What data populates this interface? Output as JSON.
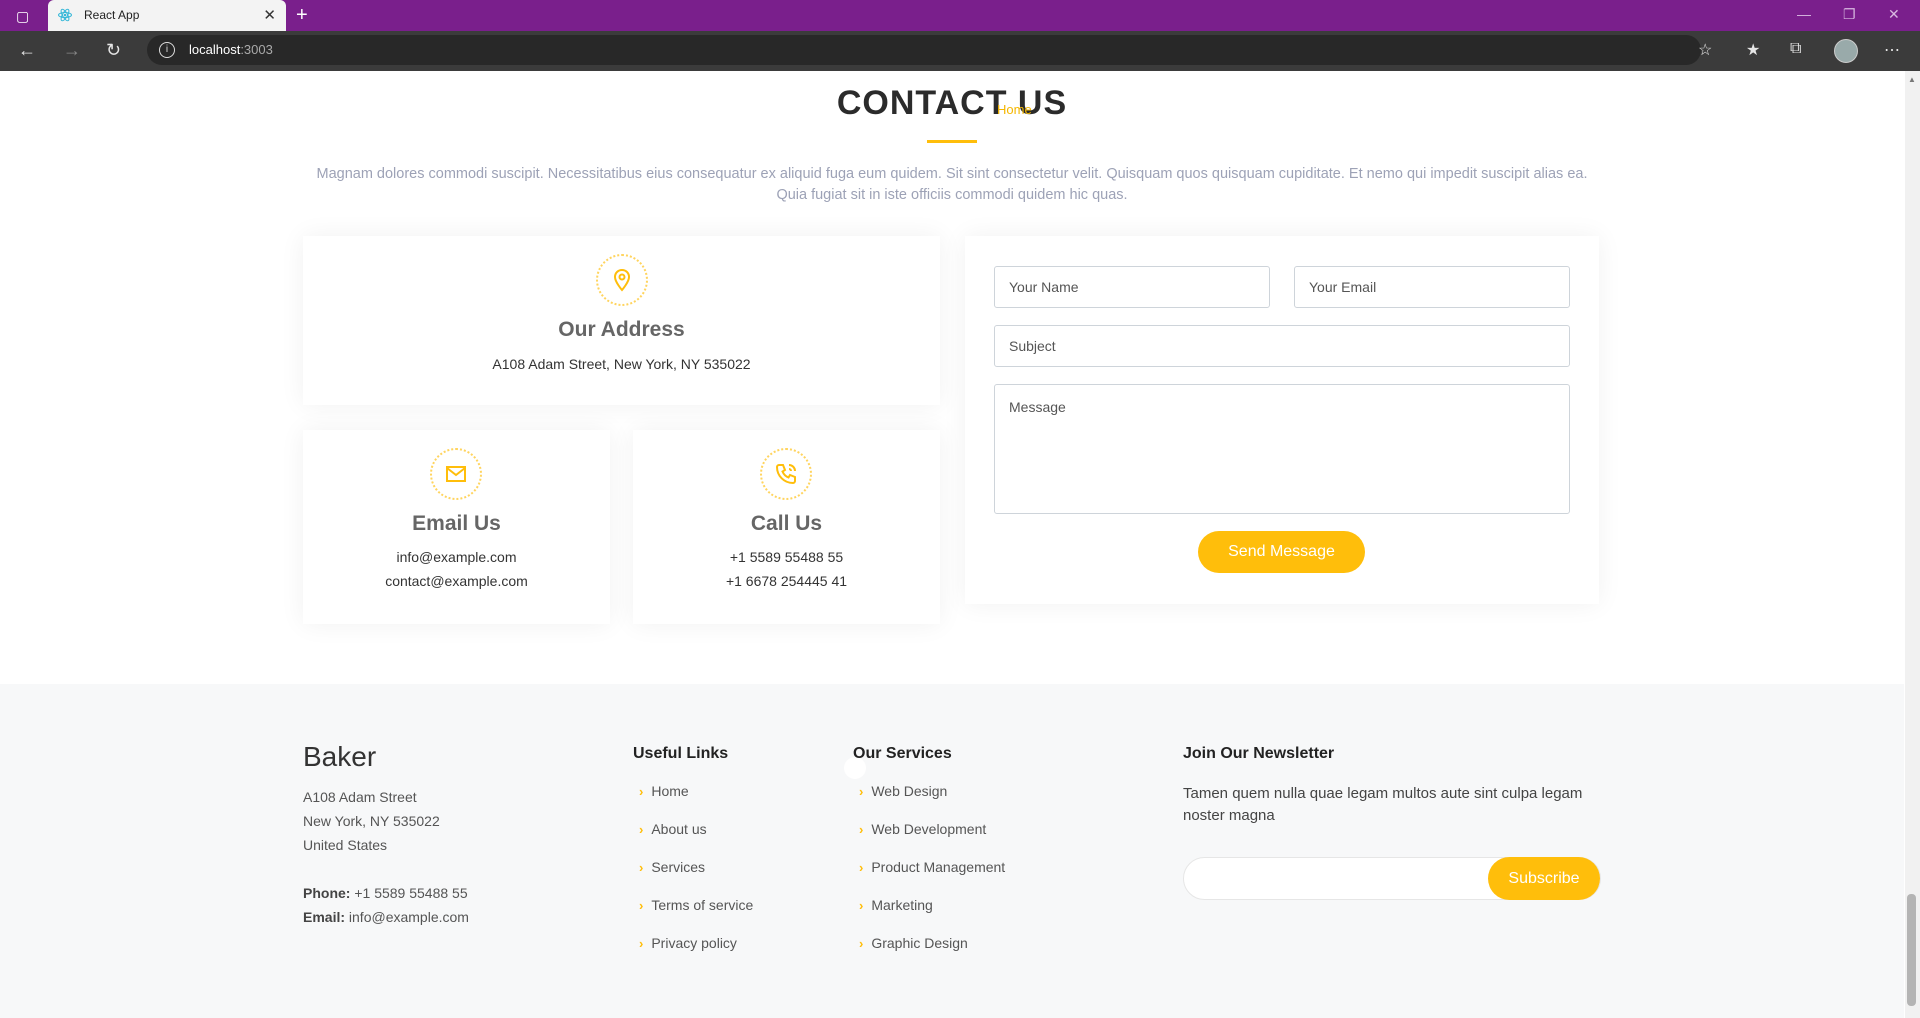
{
  "browser": {
    "tab_title": "React App",
    "url_host": "localhost",
    "url_port": ":3003"
  },
  "section": {
    "title": "CONTACT US",
    "overlay_link": "Home",
    "description": "Magnam dolores commodi suscipit. Necessitatibus eius consequatur ex aliquid fuga eum quidem. Sit sint consectetur velit. Quisquam quos quisquam cupiditate. Et nemo qui impedit suscipit alias ea. Quia fugiat sit in iste officiis commodi quidem hic quas."
  },
  "info": {
    "address": {
      "title": "Our Address",
      "text": "A108 Adam Street, New York, NY 535022"
    },
    "email": {
      "title": "Email Us",
      "line1": "info@example.com",
      "line2": "contact@example.com"
    },
    "call": {
      "title": "Call Us",
      "line1": "+1 5589 55488 55",
      "line2": "+1 6678 254445 41"
    }
  },
  "form": {
    "name_placeholder": "Your Name",
    "email_placeholder": "Your Email",
    "subject_placeholder": "Subject",
    "message_placeholder": "Message",
    "submit_label": "Send Message"
  },
  "footer": {
    "brand": "Baker",
    "address_line1": "A108 Adam Street",
    "address_line2": "New York, NY 535022",
    "address_line3": "United States",
    "phone_label": "Phone:",
    "phone_value": " +1 5589 55488 55",
    "email_label": "Email:",
    "email_value": " info@example.com",
    "useful_links_title": "Useful Links",
    "useful_links": [
      "Home",
      "About us",
      "Services",
      "Terms of service",
      "Privacy policy"
    ],
    "services_title": "Our Services",
    "services": [
      "Web Design",
      "Web Development",
      "Product Management",
      "Marketing",
      "Graphic Design"
    ],
    "newsletter_title": "Join Our Newsletter",
    "newsletter_text": "Tamen quem nulla quae legam multos aute sint culpa legam noster magna",
    "subscribe_label": "Subscribe"
  },
  "colors": {
    "accent": "#ffbe0b",
    "titlebar": "#7a1f8c",
    "footer_bg": "#f7f8f9"
  }
}
